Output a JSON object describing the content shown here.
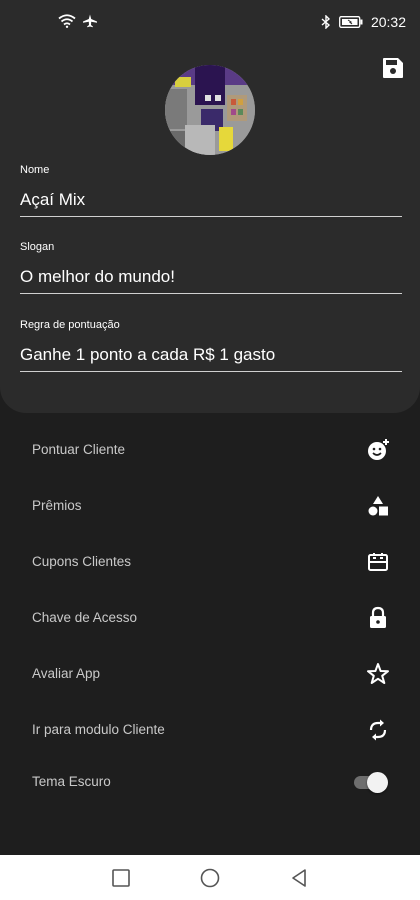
{
  "status_bar": {
    "time": "20:32",
    "left_icons": [
      "wifi-icon",
      "airplane-icon"
    ],
    "right_icons": [
      "bluetooth-icon",
      "battery-icon"
    ]
  },
  "profile": {
    "name_label": "Nome",
    "name_value": "Açaí Mix",
    "slogan_label": "Slogan",
    "slogan_value": "O melhor do mundo!",
    "rule_label": "Regra de pontuação",
    "rule_value": "Ganhe 1 ponto a cada R$ 1 gasto"
  },
  "menu": {
    "items": [
      {
        "label": "Pontuar Cliente",
        "icon": "face-add-icon"
      },
      {
        "label": "Prêmios",
        "icon": "shapes-icon"
      },
      {
        "label": "Cupons Clientes",
        "icon": "ticket-icon"
      },
      {
        "label": "Chave de Acesso",
        "icon": "lock-icon"
      },
      {
        "label": "Avaliar App",
        "icon": "star-icon"
      },
      {
        "label": "Ir para modulo Cliente",
        "icon": "sync-icon"
      },
      {
        "label": "Tema Escuro",
        "icon": "toggle-switch",
        "toggle_on": true
      }
    ]
  },
  "nav_bar": {
    "buttons": [
      "recents-square-icon",
      "home-circle-icon",
      "back-triangle-icon"
    ]
  },
  "colors": {
    "background": "#1e1e1e",
    "card": "#2b2b2b",
    "menu_text": "#c9c9c9",
    "accent_purple": "#3d1a6e",
    "accent_yellow": "#e6d83a"
  }
}
